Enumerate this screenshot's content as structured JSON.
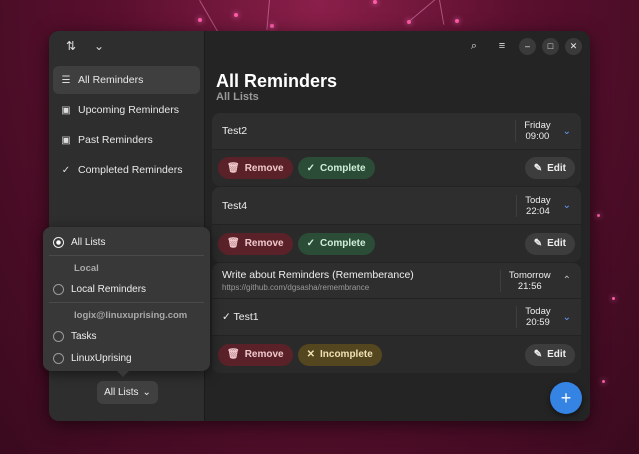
{
  "sidebar": {
    "items": [
      {
        "label": "All Reminders",
        "icon": "list-icon",
        "active": true
      },
      {
        "label": "Upcoming Reminders",
        "icon": "calendar-upcoming-icon"
      },
      {
        "label": "Past Reminders",
        "icon": "calendar-past-icon"
      },
      {
        "label": "Completed Reminders",
        "icon": "checkmark-icon"
      }
    ]
  },
  "main": {
    "title": "All Reminders",
    "subtitle": "All Lists"
  },
  "reminders": [
    {
      "title": "Test2",
      "day": "Friday",
      "time": "09:00",
      "remove": "Remove",
      "status_action": "Complete",
      "edit": "Edit"
    },
    {
      "title": "Test4",
      "day": "Today",
      "time": "22:04",
      "remove": "Remove",
      "status_action": "Complete",
      "edit": "Edit"
    },
    {
      "title": "Write about Reminders (Rememberance)",
      "url": "https://github.com/dgsasha/remembrance",
      "day": "Tomorrow",
      "time": "21:56"
    },
    {
      "title": "Test1",
      "day": "Today",
      "time": "20:59",
      "remove": "Remove",
      "status_action": "Incomplete",
      "edit": "Edit"
    }
  ],
  "popover": {
    "all_lists": "All Lists",
    "local_header": "Local",
    "local_item": "Local Reminders",
    "account_header": "logix@linuxuprising.com",
    "account_items": [
      "Tasks",
      "LinuxUprising"
    ]
  },
  "list_dropdown": {
    "label": "All Lists"
  },
  "colors": {
    "accent": "#3584e4",
    "remove": "#5a2228",
    "complete": "#2b4d37",
    "incomplete": "#54461e"
  }
}
